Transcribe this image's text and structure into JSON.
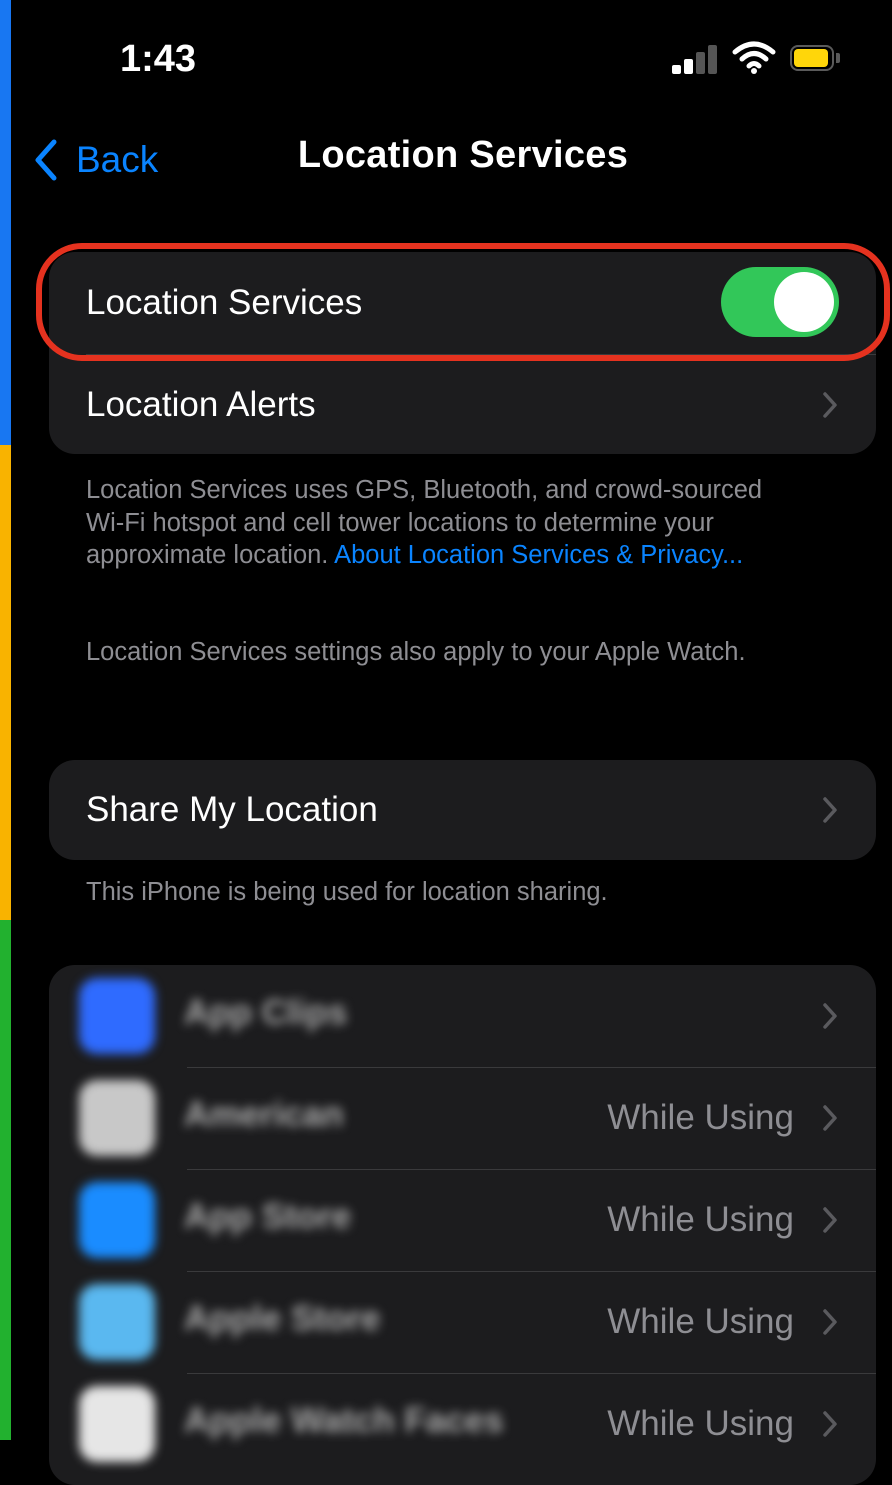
{
  "status_bar": {
    "time": "1:43",
    "icons": [
      "signal-icon",
      "wifi-icon",
      "battery-icon"
    ]
  },
  "nav": {
    "back_label": "Back",
    "title": "Location Services"
  },
  "location_group": {
    "toggle_label": "Location Services",
    "toggle_on": true,
    "alerts_label": "Location Alerts"
  },
  "description": {
    "text": "Location Services uses GPS, Bluetooth, and crowd-sourced Wi-Fi hotspot and cell tower locations to determine your approximate location. ",
    "link": "About Location Services & Privacy...",
    "watch_note": "Location Services settings also apply to your Apple Watch."
  },
  "share_group": {
    "label": "Share My Location",
    "footer": "This iPhone is being used for location sharing."
  },
  "apps": [
    {
      "name": "App Clips",
      "value": "",
      "icon_color": "#2f6bff"
    },
    {
      "name": "American",
      "value": "While Using",
      "icon_color": "#c8c8c8"
    },
    {
      "name": "App Store",
      "value": "While Using",
      "icon_color": "#1a8cff"
    },
    {
      "name": "Apple Store",
      "value": "While Using",
      "icon_color": "#5ab8f0"
    },
    {
      "name": "Apple Watch Faces",
      "value": "While Using",
      "icon_color": "#e6e6e6"
    }
  ],
  "colors": {
    "accent": "#0a84ff",
    "toggle_on": "#32c759",
    "highlight": "#e5321f",
    "battery": "#ffd60a"
  }
}
